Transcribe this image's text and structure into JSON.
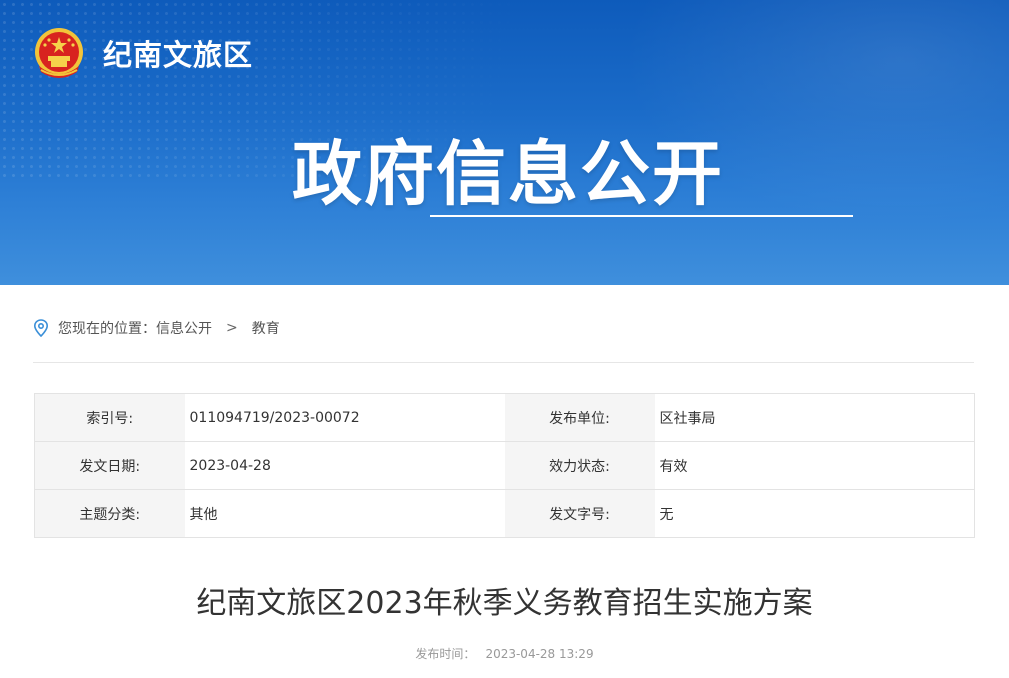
{
  "header": {
    "site_name": "纪南文旅区",
    "banner_title": "政府信息公开"
  },
  "breadcrumb": {
    "prefix": "您现在的位置：",
    "items": [
      "信息公开",
      "教育"
    ],
    "separator": ">"
  },
  "meta": {
    "rows": [
      {
        "label1": "索引号:",
        "value1": "011094719/2023-00072",
        "label2": "发布单位:",
        "value2": "区社事局"
      },
      {
        "label1": "发文日期:",
        "value1": "2023-04-28",
        "label2": "效力状态:",
        "value2": "有效"
      },
      {
        "label1": "主题分类:",
        "value1": "其他",
        "label2": "发文字号:",
        "value2": "无"
      }
    ]
  },
  "article": {
    "title": "纪南文旅区2023年秋季义务教育招生实施方案",
    "publish_label": "发布时间：",
    "publish_time": "2023-04-28 13:29"
  },
  "colors": {
    "banner_top": "#0e5bbb",
    "banner_bottom": "#3f8fdc",
    "accent_icon": "#3a8fd8"
  }
}
